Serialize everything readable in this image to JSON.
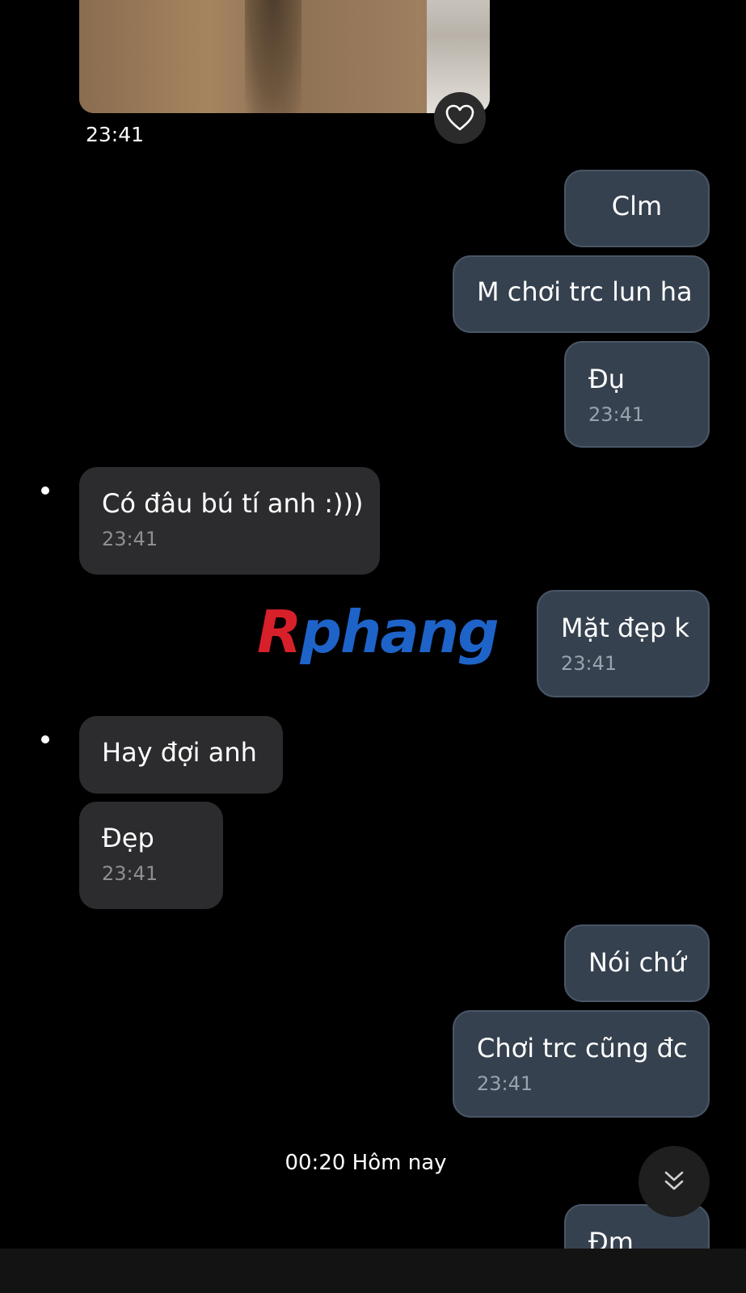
{
  "thread": {
    "photo_message": {
      "time": "23:41",
      "like_icon": "heart-icon"
    },
    "messages": [
      {
        "id": "m1",
        "direction": "outgoing",
        "text": "Clm",
        "time": ""
      },
      {
        "id": "m2",
        "direction": "outgoing",
        "text": "M chơi trc lun ha",
        "time": ""
      },
      {
        "id": "m3",
        "direction": "outgoing",
        "text": "Đụ",
        "time": "23:41"
      },
      {
        "id": "m4",
        "direction": "incoming",
        "text": "Có đâu bú tí anh :)))",
        "time": "23:41"
      },
      {
        "id": "m5",
        "direction": "outgoing",
        "text": "Mặt đẹp k",
        "time": "23:41"
      },
      {
        "id": "m6",
        "direction": "incoming",
        "text": "Hay đợi anh",
        "time": ""
      },
      {
        "id": "m7",
        "direction": "incoming",
        "text": "Đẹp",
        "time": "23:41"
      },
      {
        "id": "m8",
        "direction": "outgoing",
        "text": "Nói chứ",
        "time": ""
      },
      {
        "id": "m9",
        "direction": "outgoing",
        "text": "Chơi trc cũng đc",
        "time": "23:41"
      },
      {
        "id": "m10",
        "direction": "outgoing",
        "text": "Đm",
        "time": ""
      }
    ],
    "day_divider": "00:20 Hôm nay"
  },
  "watermark": {
    "first_letter": "R",
    "rest": "phang"
  },
  "controls": {
    "scroll_down_icon": "double-chevron-down-icon"
  },
  "colors": {
    "outgoing_bubble": "#36414f",
    "incoming_bubble": "#2c2c2e",
    "background": "#000000"
  }
}
